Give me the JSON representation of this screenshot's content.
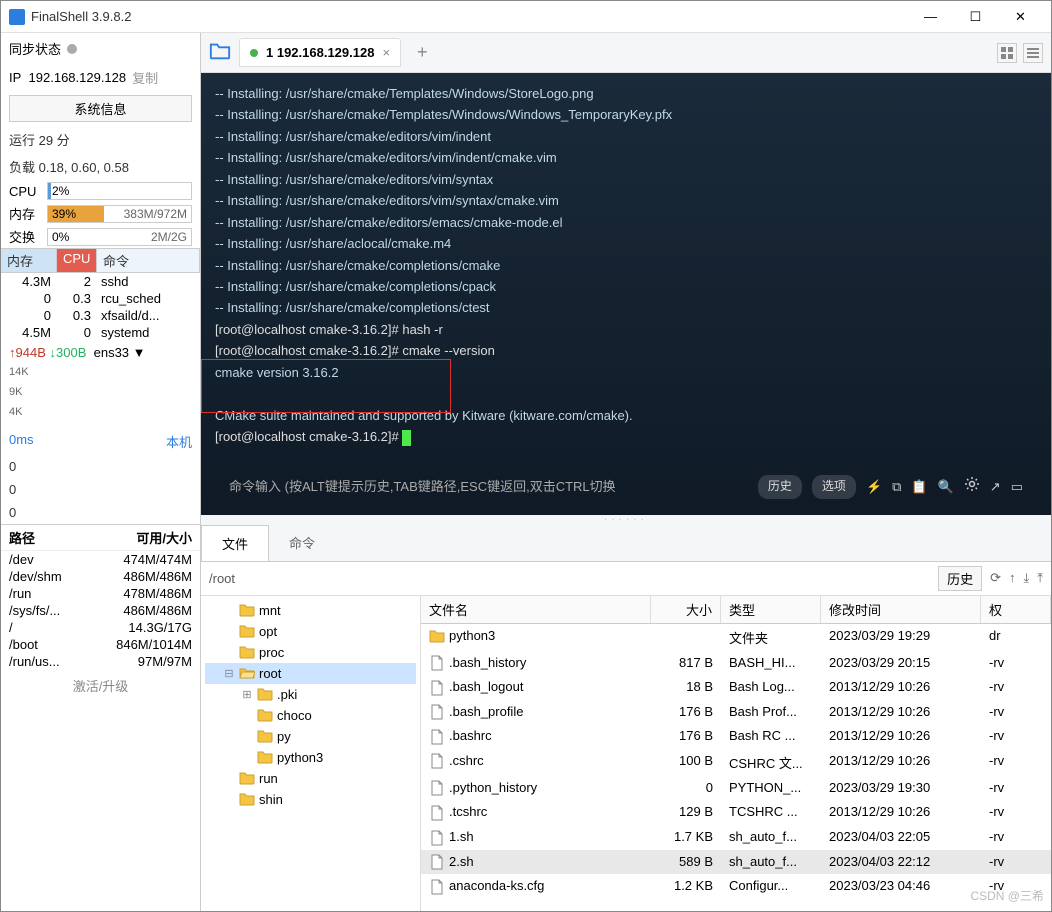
{
  "titlebar": {
    "title": "FinalShell 3.9.8.2"
  },
  "sidebar": {
    "sync_label": "同步状态",
    "ip_label": "IP",
    "ip": "192.168.129.128",
    "copy": "复制",
    "sysinfo_btn": "系统信息",
    "uptime": "运行 29 分",
    "load": "负载 0.18, 0.60, 0.58",
    "cpu_label": "CPU",
    "cpu_val": "2%",
    "mem_label": "内存",
    "mem_val": "39%",
    "mem_detail": "383M/972M",
    "swap_label": "交换",
    "swap_val": "0%",
    "swap_detail": "2M/2G",
    "proc_head": {
      "mem": "内存",
      "cpu": "CPU",
      "cmd": "命令"
    },
    "procs": [
      {
        "mem": "4.3M",
        "cpu": "2",
        "cmd": "sshd"
      },
      {
        "mem": "0",
        "cpu": "0.3",
        "cmd": "rcu_sched"
      },
      {
        "mem": "0",
        "cpu": "0.3",
        "cmd": "xfsaild/d..."
      },
      {
        "mem": "4.5M",
        "cpu": "0",
        "cmd": "systemd"
      }
    ],
    "net_up": "944B",
    "net_down": "300B",
    "net_if": "ens33",
    "chart_labels": [
      "14K",
      "9K",
      "4K"
    ],
    "ping": "0ms",
    "ping_r": "本机",
    "ping_vals": [
      "0",
      "0",
      "0"
    ],
    "path_head": {
      "path": "路径",
      "size": "可用/大小"
    },
    "paths": [
      {
        "path": "/dev",
        "size": "474M/474M"
      },
      {
        "path": "/dev/shm",
        "size": "486M/486M"
      },
      {
        "path": "/run",
        "size": "478M/486M"
      },
      {
        "path": "/sys/fs/...",
        "size": "486M/486M"
      },
      {
        "path": "/",
        "size": "14.3G/17G"
      },
      {
        "path": "/boot",
        "size": "846M/1014M"
      },
      {
        "path": "/run/us...",
        "size": "97M/97M"
      }
    ],
    "activate": "激活/升级"
  },
  "tabbar": {
    "tab_title": "1 192.168.129.128"
  },
  "terminal": {
    "lines": [
      "-- Installing: /usr/share/cmake/Templates/Windows/StoreLogo.png",
      "-- Installing: /usr/share/cmake/Templates/Windows/Windows_TemporaryKey.pfx",
      "-- Installing: /usr/share/cmake/editors/vim/indent",
      "-- Installing: /usr/share/cmake/editors/vim/indent/cmake.vim",
      "-- Installing: /usr/share/cmake/editors/vim/syntax",
      "-- Installing: /usr/share/cmake/editors/vim/syntax/cmake.vim",
      "-- Installing: /usr/share/cmake/editors/emacs/cmake-mode.el",
      "-- Installing: /usr/share/aclocal/cmake.m4",
      "-- Installing: /usr/share/cmake/completions/cmake",
      "-- Installing: /usr/share/cmake/completions/cpack",
      "-- Installing: /usr/share/cmake/completions/ctest"
    ],
    "prompt1": "[root@localhost cmake-3.16.2]# hash -r",
    "prompt2": "[root@localhost cmake-3.16.2]# cmake --version",
    "version": "cmake version 3.16.2",
    "kitware": "CMake suite maintained and supported by Kitware (kitware.com/cmake).",
    "prompt3": "[root@localhost cmake-3.16.2]# ",
    "cmd_hint": "命令输入 (按ALT键提示历史,TAB键路径,ESC键返回,双击CTRL切换",
    "history_btn": "历史",
    "option_btn": "选项"
  },
  "filetabs": {
    "files": "文件",
    "cmds": "命令"
  },
  "filebar": {
    "path": "/root",
    "history": "历史"
  },
  "tree": [
    {
      "name": "mnt",
      "indent": 1
    },
    {
      "name": "opt",
      "indent": 1
    },
    {
      "name": "proc",
      "indent": 1
    },
    {
      "name": "root",
      "indent": 1,
      "sel": true,
      "exp": "⊟",
      "open": true
    },
    {
      "name": ".pki",
      "indent": 2,
      "exp": "⊞"
    },
    {
      "name": "choco",
      "indent": 2
    },
    {
      "name": "py",
      "indent": 2
    },
    {
      "name": "python3",
      "indent": 2
    },
    {
      "name": "run",
      "indent": 1
    },
    {
      "name": "shin",
      "indent": 1
    }
  ],
  "filelist": {
    "head": {
      "name": "文件名",
      "size": "大小",
      "type": "类型",
      "mtime": "修改时间",
      "perm": "权"
    },
    "rows": [
      {
        "name": "python3",
        "size": "",
        "type": "文件夹",
        "mtime": "2023/03/29 19:29",
        "perm": "dr",
        "icon": "folder"
      },
      {
        "name": ".bash_history",
        "size": "817 B",
        "type": "BASH_HI...",
        "mtime": "2023/03/29 20:15",
        "perm": "-rv",
        "icon": "file"
      },
      {
        "name": ".bash_logout",
        "size": "18 B",
        "type": "Bash Log...",
        "mtime": "2013/12/29 10:26",
        "perm": "-rv",
        "icon": "file"
      },
      {
        "name": ".bash_profile",
        "size": "176 B",
        "type": "Bash Prof...",
        "mtime": "2013/12/29 10:26",
        "perm": "-rv",
        "icon": "file"
      },
      {
        "name": ".bashrc",
        "size": "176 B",
        "type": "Bash RC ...",
        "mtime": "2013/12/29 10:26",
        "perm": "-rv",
        "icon": "file"
      },
      {
        "name": ".cshrc",
        "size": "100 B",
        "type": "CSHRC 文...",
        "mtime": "2013/12/29 10:26",
        "perm": "-rv",
        "icon": "file"
      },
      {
        "name": ".python_history",
        "size": "0",
        "type": "PYTHON_...",
        "mtime": "2023/03/29 19:30",
        "perm": "-rv",
        "icon": "file"
      },
      {
        "name": ".tcshrc",
        "size": "129 B",
        "type": "TCSHRC ...",
        "mtime": "2013/12/29 10:26",
        "perm": "-rv",
        "icon": "file"
      },
      {
        "name": "1.sh",
        "size": "1.7 KB",
        "type": "sh_auto_f...",
        "mtime": "2023/04/03 22:05",
        "perm": "-rv",
        "icon": "sh"
      },
      {
        "name": "2.sh",
        "size": "589 B",
        "type": "sh_auto_f...",
        "mtime": "2023/04/03 22:12",
        "perm": "-rv",
        "icon": "sh",
        "sel": true
      },
      {
        "name": "anaconda-ks.cfg",
        "size": "1.2 KB",
        "type": "Configur...",
        "mtime": "2023/03/23 04:46",
        "perm": "-rv",
        "icon": "cfg"
      }
    ]
  },
  "watermark": "CSDN @三希"
}
